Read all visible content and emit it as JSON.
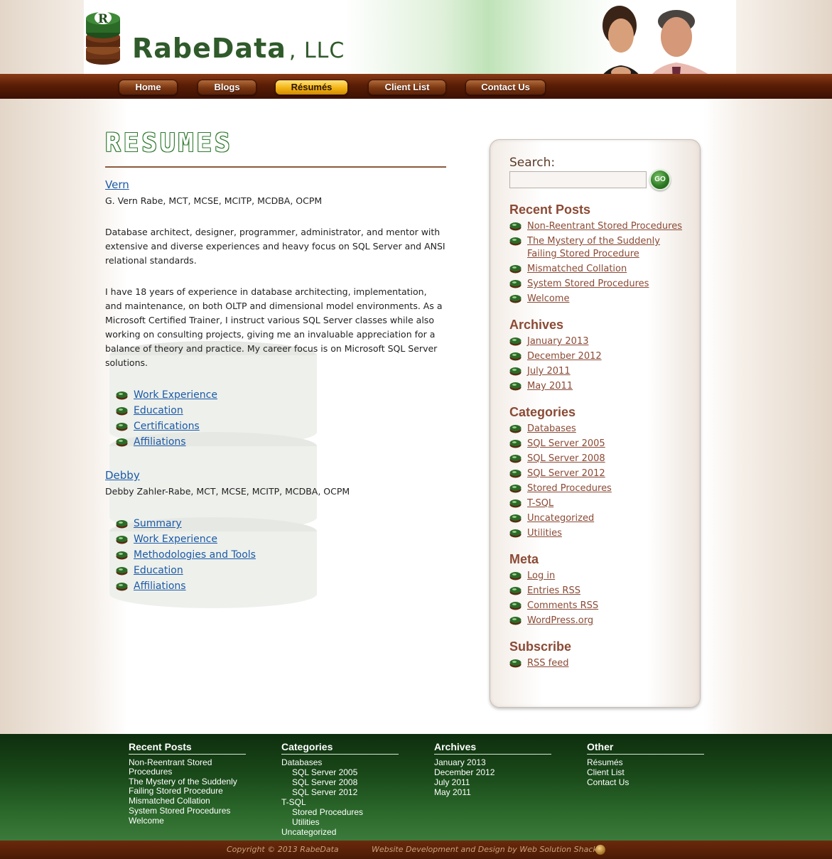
{
  "brand": {
    "name": "RabeData",
    "suffix": ", LLC"
  },
  "nav": [
    {
      "label": "Home",
      "active": false
    },
    {
      "label": "Blogs",
      "active": false
    },
    {
      "label": "Résumés",
      "active": true
    },
    {
      "label": "Client List",
      "active": false
    },
    {
      "label": "Contact Us",
      "active": false
    }
  ],
  "main": {
    "title": "RESUMES",
    "vern": {
      "name": "Vern",
      "creds": "G. Vern Rabe, MCT, MCSE, MCITP, MCDBA, OCPM",
      "para1": "Database architect, designer, programmer, administrator, and mentor with extensive and diverse experiences and heavy focus on SQL Server and ANSI relational standards.",
      "para2": "I have 18 years of experience in database architecting, implementation, and maintenance, on both OLTP and dimensional model environments. As a Microsoft Certified Trainer, I instruct various SQL Server classes while also working on consulting projects, giving me an invaluable appreciation for a balance of theory and practice. My career focus is on Microsoft SQL Server solutions.",
      "links": [
        "Work Experience",
        "Education",
        "Certifications",
        "Affiliations"
      ]
    },
    "debby": {
      "name": "Debby",
      "creds": "Debby Zahler-Rabe, MCT, MCSE, MCITP, MCDBA, OCPM",
      "links": [
        "Summary",
        "Work Experience",
        "Methodologies and Tools",
        "Education",
        "Affiliations"
      ]
    }
  },
  "sidebar": {
    "search_label": "Search:",
    "search_value": "",
    "search_button": "GO",
    "recent_heading": "Recent Posts",
    "recent": [
      "Non-Reentrant Stored Procedures",
      "The Mystery of the Suddenly Failing Stored Procedure",
      "Mismatched Collation",
      "System Stored Procedures",
      "Welcome"
    ],
    "archives_heading": "Archives",
    "archives": [
      "January 2013",
      "December 2012",
      "July 2011",
      "May 2011"
    ],
    "categories_heading": "Categories",
    "categories": [
      "Databases",
      "SQL Server 2005",
      "SQL Server 2008",
      "SQL Server 2012",
      "Stored Procedures",
      "T-SQL",
      "Uncategorized",
      "Utilities"
    ],
    "meta_heading": "Meta",
    "meta": [
      "Log in",
      "Entries RSS",
      "Comments RSS",
      "WordPress.org"
    ],
    "subscribe_heading": "Subscribe",
    "subscribe": [
      "RSS feed"
    ]
  },
  "footer": {
    "recent_heading": "Recent Posts",
    "recent": [
      "Non-Reentrant Stored Procedures",
      "The Mystery of the Suddenly Failing Stored Procedure",
      "Mismatched Collation",
      "System Stored Procedures",
      "Welcome"
    ],
    "categories_heading": "Categories",
    "categories": [
      {
        "label": "Databases",
        "sub": false
      },
      {
        "label": "SQL Server 2005",
        "sub": true
      },
      {
        "label": "SQL Server 2008",
        "sub": true
      },
      {
        "label": "SQL Server 2012",
        "sub": true
      },
      {
        "label": "T-SQL",
        "sub": false
      },
      {
        "label": "Stored Procedures",
        "sub": true
      },
      {
        "label": "Utilities",
        "sub": true
      },
      {
        "label": "Uncategorized",
        "sub": false
      }
    ],
    "archives_heading": "Archives",
    "archives": [
      "January 2013",
      "December 2012",
      "July 2011",
      "May 2011"
    ],
    "other_heading": "Other",
    "other": [
      "Résumés",
      "Client List",
      "Contact Us"
    ],
    "copyright": "Copyright © 2013 RabeData",
    "credit": "Website Development and Design by Web Solution Shack"
  },
  "colors": {
    "brand_green": "#2f5a2a",
    "nav_brown": "#5a1e06",
    "active_gold": "#f3b312",
    "link_blue": "#1a5aa8",
    "side_link": "#8b4a35"
  }
}
